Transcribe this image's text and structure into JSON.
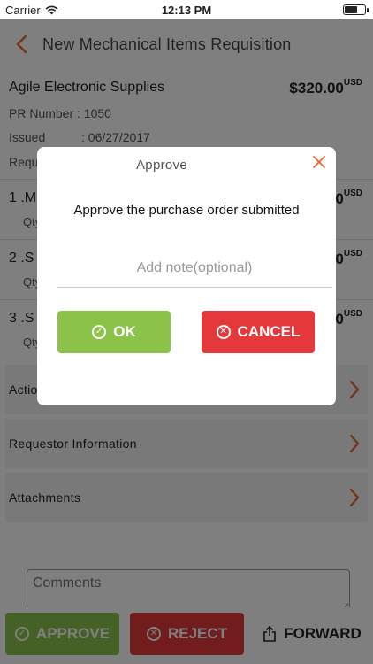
{
  "status_bar": {
    "carrier": "Carrier",
    "time": "12:13 PM"
  },
  "nav": {
    "title": "New Mechanical Items Requisition"
  },
  "summary": {
    "vendor": "Agile Electronic Supplies",
    "total": "$320.00",
    "currency": "USD",
    "pr_number_label": "PR Number :",
    "pr_number": "1050",
    "issued_label": "Issued",
    "issued_value": ": 06/27/2017",
    "requested_label": "Requ"
  },
  "items": [
    {
      "name": "1 .M",
      "qty": "Qty",
      "price": "0",
      "currency": "USD"
    },
    {
      "name": "2 .S",
      "qty": "Qty",
      "price": "0",
      "currency": "USD"
    },
    {
      "name": "3 .S",
      "qty": "Qty",
      "price": "0",
      "currency": "USD"
    }
  ],
  "sections": [
    {
      "label": "Actio"
    },
    {
      "label": "Requestor Information"
    },
    {
      "label": "Attachments"
    }
  ],
  "comments": {
    "placeholder": "Comments"
  },
  "bottom_actions": {
    "approve": "APPROVE",
    "reject": "REJECT",
    "forward": "FORWARD"
  },
  "dialog": {
    "title": "Approve",
    "message": "Approve the purchase order submitted",
    "note_placeholder": "Add note(optional)",
    "ok": "OK",
    "cancel": "CANCEL"
  },
  "colors": {
    "accent": "#e8672c",
    "approve": "#8bc34a",
    "reject": "#e5383b"
  }
}
